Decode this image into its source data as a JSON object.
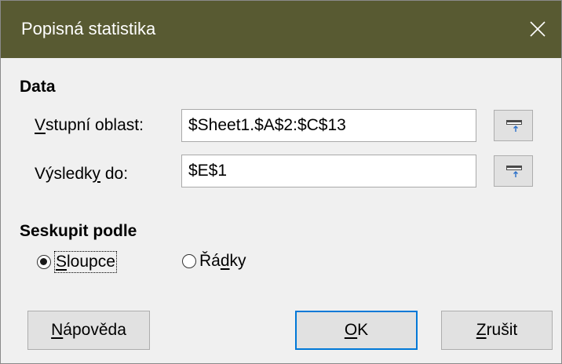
{
  "window": {
    "title": "Popisná statistika",
    "close_glyph": "×"
  },
  "data_section": {
    "heading": "Data",
    "input_range": {
      "label_pre": "",
      "label_mnemonic": "V",
      "label_post": "stupní oblast:",
      "value": "$Sheet1.$A$2:$C$13"
    },
    "results_to": {
      "label_pre": "Výsledk",
      "label_mnemonic": "y",
      "label_post": " do:",
      "value": "$E$1"
    },
    "shrink_icon": "shrink-range-icon"
  },
  "group_section": {
    "heading": "Seskupit podle",
    "options": [
      {
        "pre": "",
        "mnemonic": "S",
        "post": "loupce",
        "checked": true
      },
      {
        "pre": "Řá",
        "mnemonic": "d",
        "post": "ky",
        "checked": false
      }
    ]
  },
  "buttons": {
    "help": {
      "pre": "",
      "mnemonic": "N",
      "post": "ápověda"
    },
    "ok": {
      "pre": "",
      "mnemonic": "O",
      "post": "K"
    },
    "cancel": {
      "pre": "",
      "mnemonic": "Z",
      "post": "rušit"
    }
  },
  "colors": {
    "titlebar": "#585a32",
    "dialog_bg": "#f0f0f0",
    "default_button_border": "#0078d7"
  }
}
